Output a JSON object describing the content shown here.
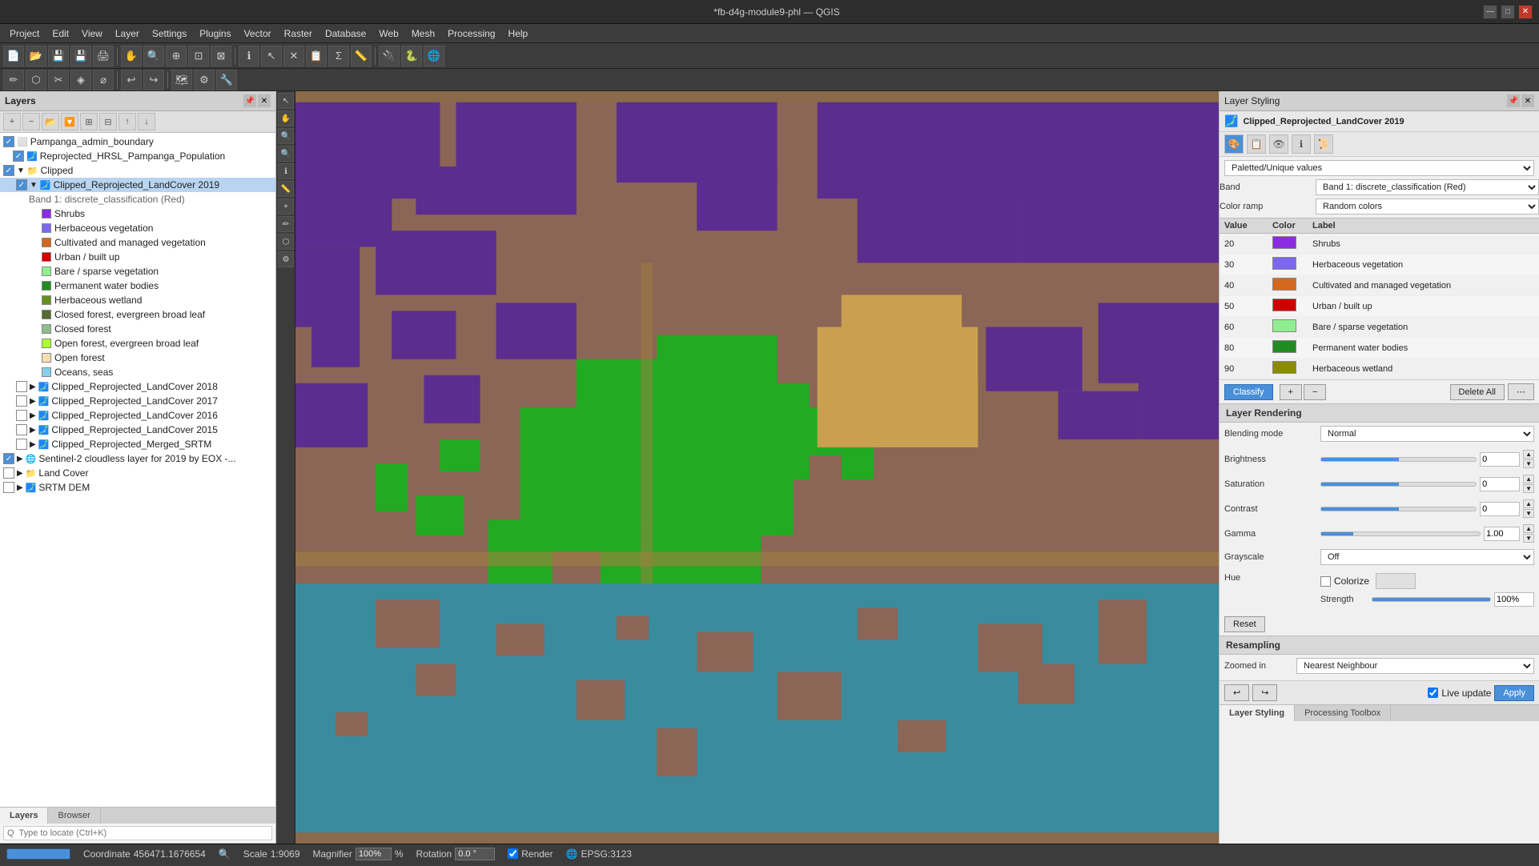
{
  "titlebar": {
    "title": "*fb-d4g-module9-phl — QGIS",
    "minimize": "—",
    "maximize": "□",
    "close": "✕"
  },
  "menubar": {
    "items": [
      "Project",
      "Edit",
      "View",
      "Layer",
      "Settings",
      "Plugins",
      "Vector",
      "Raster",
      "Database",
      "Web",
      "Mesh",
      "Processing",
      "Help"
    ]
  },
  "layers_panel": {
    "title": "Layers",
    "items": [
      {
        "id": "pampanga_boundary",
        "label": "Pampanga_admin_boundary",
        "indent": 0,
        "checked": true,
        "type": "polygon"
      },
      {
        "id": "reprojected_hrsl",
        "label": "Reprojected_HRSL_Pampanga_Population",
        "indent": 0,
        "checked": true,
        "type": "raster"
      },
      {
        "id": "clipped_group",
        "label": "Clipped",
        "indent": 0,
        "checked": true,
        "type": "group"
      },
      {
        "id": "clipped_landcover_2019",
        "label": "Clipped_Reprojected_LandCover 2019",
        "indent": 1,
        "checked": true,
        "type": "raster",
        "selected": true
      },
      {
        "id": "band1",
        "label": "Band 1: discrete_classification (Red)",
        "indent": 2,
        "checked": false,
        "type": "info"
      },
      {
        "id": "shrubs_swatch",
        "label": "Shrubs",
        "indent": 3,
        "checked": false,
        "type": "legend",
        "color": "#8B2BE2"
      },
      {
        "id": "herb_veg_swatch",
        "label": "Herbaceous vegetation",
        "indent": 3,
        "checked": false,
        "type": "legend",
        "color": "#7B68EE"
      },
      {
        "id": "cultivated_swatch",
        "label": "Cultivated and managed vegetation",
        "indent": 3,
        "checked": false,
        "type": "legend",
        "color": "#D2691E"
      },
      {
        "id": "urban_swatch",
        "label": "Urban / built up",
        "indent": 3,
        "checked": false,
        "type": "legend",
        "color": "#CC0000"
      },
      {
        "id": "bare_swatch",
        "label": "Bare / sparse vegetation",
        "indent": 3,
        "checked": false,
        "type": "legend",
        "color": "#90EE90"
      },
      {
        "id": "water_swatch",
        "label": "Permanent water bodies",
        "indent": 3,
        "checked": false,
        "type": "legend",
        "color": "#228B22"
      },
      {
        "id": "herbwet_swatch",
        "label": "Herbaceous wetland",
        "indent": 3,
        "checked": false,
        "type": "legend",
        "color": "#6B8E23"
      },
      {
        "id": "closed_broad_swatch",
        "label": "Closed forest, evergreen broad leaf",
        "indent": 3,
        "checked": false,
        "type": "legend",
        "color": "#556B2F"
      },
      {
        "id": "closed_forest_swatch",
        "label": "Closed forest",
        "indent": 3,
        "checked": false,
        "type": "legend",
        "color": "#8FBC8F"
      },
      {
        "id": "open_forest_swatch",
        "label": "Open forest, evergreen broad leaf",
        "indent": 3,
        "checked": false,
        "type": "legend",
        "color": "#ADFF2F"
      },
      {
        "id": "open_forest2_swatch",
        "label": "Open forest",
        "indent": 3,
        "checked": false,
        "type": "legend",
        "color": "#F5DEB3"
      },
      {
        "id": "oceans_swatch",
        "label": "Oceans, seas",
        "indent": 3,
        "checked": false,
        "type": "legend",
        "color": "#87CEEB"
      },
      {
        "id": "clipped_2018",
        "label": "Clipped_Reprojected_LandCover 2018",
        "indent": 1,
        "checked": false,
        "type": "raster"
      },
      {
        "id": "clipped_2017",
        "label": "Clipped_Reprojected_LandCover 2017",
        "indent": 1,
        "checked": false,
        "type": "raster"
      },
      {
        "id": "clipped_2016",
        "label": "Clipped_Reprojected_LandCover 2016",
        "indent": 1,
        "checked": false,
        "type": "raster"
      },
      {
        "id": "clipped_2015",
        "label": "Clipped_Reprojected_LandCover 2015",
        "indent": 1,
        "checked": false,
        "type": "raster"
      },
      {
        "id": "clipped_merged",
        "label": "Clipped_Reprojected_Merged_SRTM",
        "indent": 1,
        "checked": false,
        "type": "raster"
      },
      {
        "id": "sentinel2",
        "label": "Sentinel-2 cloudless layer for 2019 by EOX -...",
        "indent": 0,
        "checked": true,
        "type": "raster"
      },
      {
        "id": "landcover_group",
        "label": "Land Cover",
        "indent": 0,
        "checked": false,
        "type": "group"
      },
      {
        "id": "srtm_dem",
        "label": "SRTM DEM",
        "indent": 0,
        "checked": false,
        "type": "raster"
      }
    ],
    "tabs": [
      "Layers",
      "Browser"
    ],
    "active_tab": "Layers",
    "search_placeholder": "Q  Type to locate (Ctrl+K)"
  },
  "right_panel": {
    "title": "Layer Styling",
    "layer_name": "Clipped_Reprojected_LandCover 2019",
    "renderer": "Paletted/Unique values",
    "band": "Band 1: discrete_classification (Red)",
    "color_ramp": "Random colors",
    "columns": [
      "Value",
      "Color",
      "Label"
    ],
    "rows": [
      {
        "value": "20",
        "color": "#8B2BE2",
        "label": "Shrubs"
      },
      {
        "value": "30",
        "color": "#7B68EE",
        "label": "Herbaceous vegetation"
      },
      {
        "value": "40",
        "color": "#D2691E",
        "label": "Cultivated and managed vegetation"
      },
      {
        "value": "50",
        "color": "#CC0000",
        "label": "Urban / built up"
      },
      {
        "value": "60",
        "color": "#90EE90",
        "label": "Bare / sparse vegetation"
      },
      {
        "value": "80",
        "color": "#228B22",
        "label": "Permanent water bodies"
      },
      {
        "value": "90",
        "color": "#8B8B00",
        "label": "Herbaceous wetland"
      }
    ],
    "classify_label": "Classify",
    "delete_all_label": "Delete All",
    "rendering_section": "Layer Rendering",
    "blending_mode_label": "Blending mode",
    "blending_mode": "Normal",
    "brightness_label": "Brightness",
    "brightness_value": "0",
    "saturation_label": "Saturation",
    "saturation_value": "0",
    "contrast_label": "Contrast",
    "contrast_value": "0",
    "gamma_label": "Gamma",
    "gamma_value": "1.00",
    "grayscale_label": "Grayscale",
    "grayscale_value": "Off",
    "hue_label": "Hue",
    "colorize_label": "Colorize",
    "strength_label": "Strength",
    "strength_value": "100%",
    "reset_label": "Reset",
    "resampling_section": "Resampling",
    "zoomed_in_label": "Zoomed in",
    "zoomed_in_value": "Nearest Neighbour",
    "live_update_label": "Live update",
    "apply_label": "Apply",
    "bottom_tabs": [
      "Layer Styling",
      "Processing Toolbox"
    ]
  },
  "statusbar": {
    "coordinate_label": "Coordinate",
    "coordinate_value": "456471.1676654",
    "scale_label": "Scale",
    "scale_value": "1:9069",
    "magnifier_label": "Magnifier",
    "magnifier_value": "100%",
    "rotation_label": "Rotation",
    "rotation_value": "0.0 °",
    "render_label": "Render",
    "epsg_label": "EPSG:3123"
  }
}
